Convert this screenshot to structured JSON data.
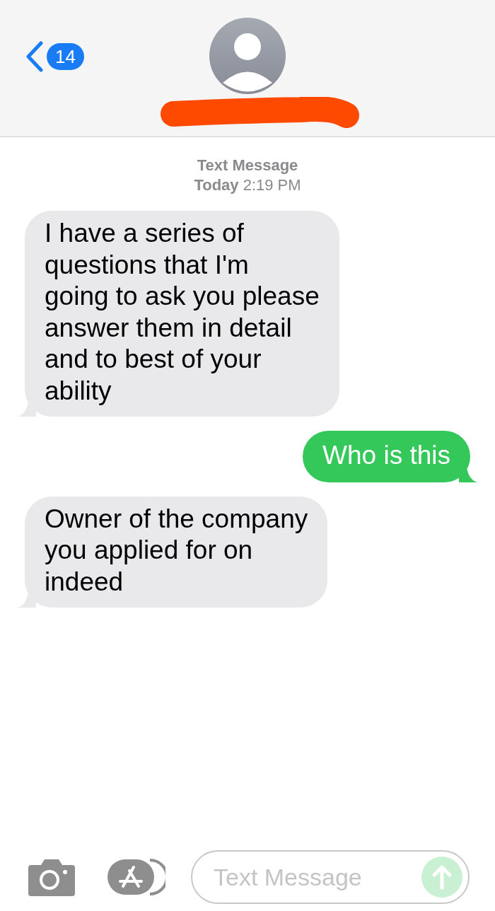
{
  "header": {
    "back_badge": "14"
  },
  "timestamp": {
    "label": "Text Message",
    "time": "**Today** 2:19 PM"
  },
  "messages": [
    {
      "kind": "incoming",
      "text": "I have a series of\nquestions that I'm\ngoing to ask you please\nanswer them in detail\nand to best of your\nability"
    },
    {
      "kind": "outgoing",
      "text": "Who is this"
    },
    {
      "kind": "incoming",
      "text": "Owner of the company\nyou applied for on\nindeed"
    }
  ],
  "composer": {
    "placeholder": "Text Message",
    "send_disabled": true
  }
}
